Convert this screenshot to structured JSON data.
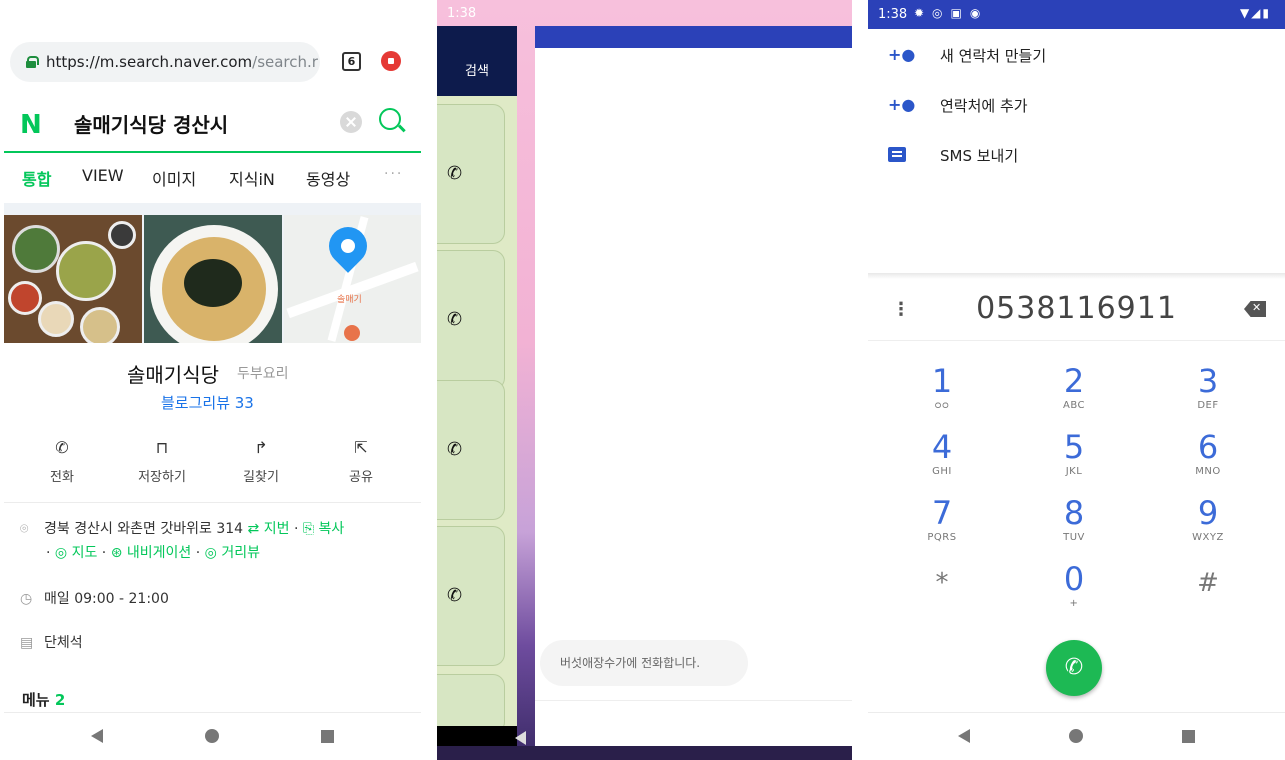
{
  "browser": {
    "url_host": "https://m.search.naver.com",
    "url_path": "/search.r",
    "tab_count": "6",
    "search_query": "솔매기식당 경산시",
    "logo": "N",
    "tabs": [
      "통합",
      "VIEW",
      "이미지",
      "지식iN",
      "동영상"
    ],
    "tabs_more": "···",
    "map_label": "솔매기",
    "place_name": "솔매기식당",
    "place_category": "두부요리",
    "blog_review": "블로그리뷰 33",
    "actions": [
      {
        "label": "전화",
        "icon": "phone-icon"
      },
      {
        "label": "저장하기",
        "icon": "bookmark-icon"
      },
      {
        "label": "길찾기",
        "icon": "directions-icon"
      },
      {
        "label": "공유",
        "icon": "share-icon"
      }
    ],
    "address": "경북 경산시 와촌면 갓바위로 314",
    "address_links": {
      "jibun": "⇄ 지번",
      "copy": "⎘ 복사",
      "map": "◎ 지도",
      "navi": "⊛ 내비게이션",
      "street": "◎ 거리뷰"
    },
    "hours": "매일 09:00 - 21:00",
    "seating": "단체석",
    "menu_title": "메뉴",
    "menu_count": "2"
  },
  "overlay": {
    "status_time": "1:38",
    "search_button": "검색",
    "toast": "버섯애장수가에 전화합니다."
  },
  "dialer": {
    "status_time": "1:38",
    "options": [
      {
        "label": "새 연락처 만들기",
        "icon": "add-contact-icon"
      },
      {
        "label": "연락처에 추가",
        "icon": "add-contact-icon"
      },
      {
        "label": "SMS 보내기",
        "icon": "message-icon"
      }
    ],
    "number": "0538116911",
    "keys": [
      {
        "d": "1",
        "s": "ᴑᴑ"
      },
      {
        "d": "2",
        "s": "ABC"
      },
      {
        "d": "3",
        "s": "DEF"
      },
      {
        "d": "4",
        "s": "GHI"
      },
      {
        "d": "5",
        "s": "JKL"
      },
      {
        "d": "6",
        "s": "MNO"
      },
      {
        "d": "7",
        "s": "PQRS"
      },
      {
        "d": "8",
        "s": "TUV"
      },
      {
        "d": "9",
        "s": "WXYZ"
      },
      {
        "d": "*",
        "s": ""
      },
      {
        "d": "0",
        "s": "+"
      },
      {
        "d": "#",
        "s": ""
      }
    ]
  },
  "colors": {
    "naver_green": "#03c75a",
    "dialer_blue": "#2b41b8",
    "call_green": "#1db954",
    "link_blue": "#1a73e8"
  }
}
